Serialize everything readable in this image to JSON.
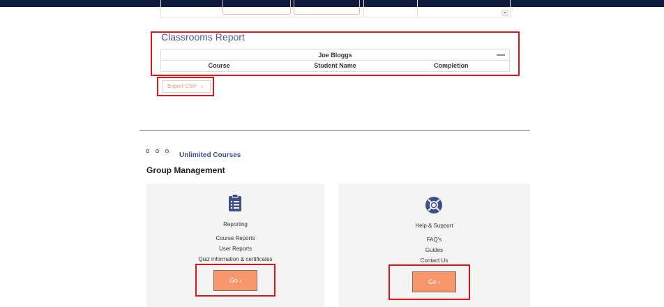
{
  "report": {
    "title": "Classrooms Report",
    "user_name": "Joe Bloggs",
    "collapse_symbol": "—",
    "columns": [
      "Course",
      "Student Name",
      "Completion"
    ],
    "export_label": "Export CSV",
    "export_chevron": "›"
  },
  "courses_tag": "Unlimited Courses",
  "group": {
    "title": "Group Management",
    "cards": [
      {
        "icon": "clipboard-icon",
        "title": "Reporting",
        "links": [
          "Course Reports",
          "User Reports",
          "Quiz information & certificates"
        ],
        "button": "Go ›"
      },
      {
        "icon": "lifebuoy-icon",
        "title": "Help & Support",
        "links": [
          "FAQ's",
          "Guides",
          "Contact Us"
        ],
        "button": "Go ›"
      }
    ]
  },
  "colors": {
    "topbar": "#0f1b3d",
    "accent": "#f7966b",
    "brand_blue": "#3c4f8a",
    "highlight": "#e0141c"
  }
}
